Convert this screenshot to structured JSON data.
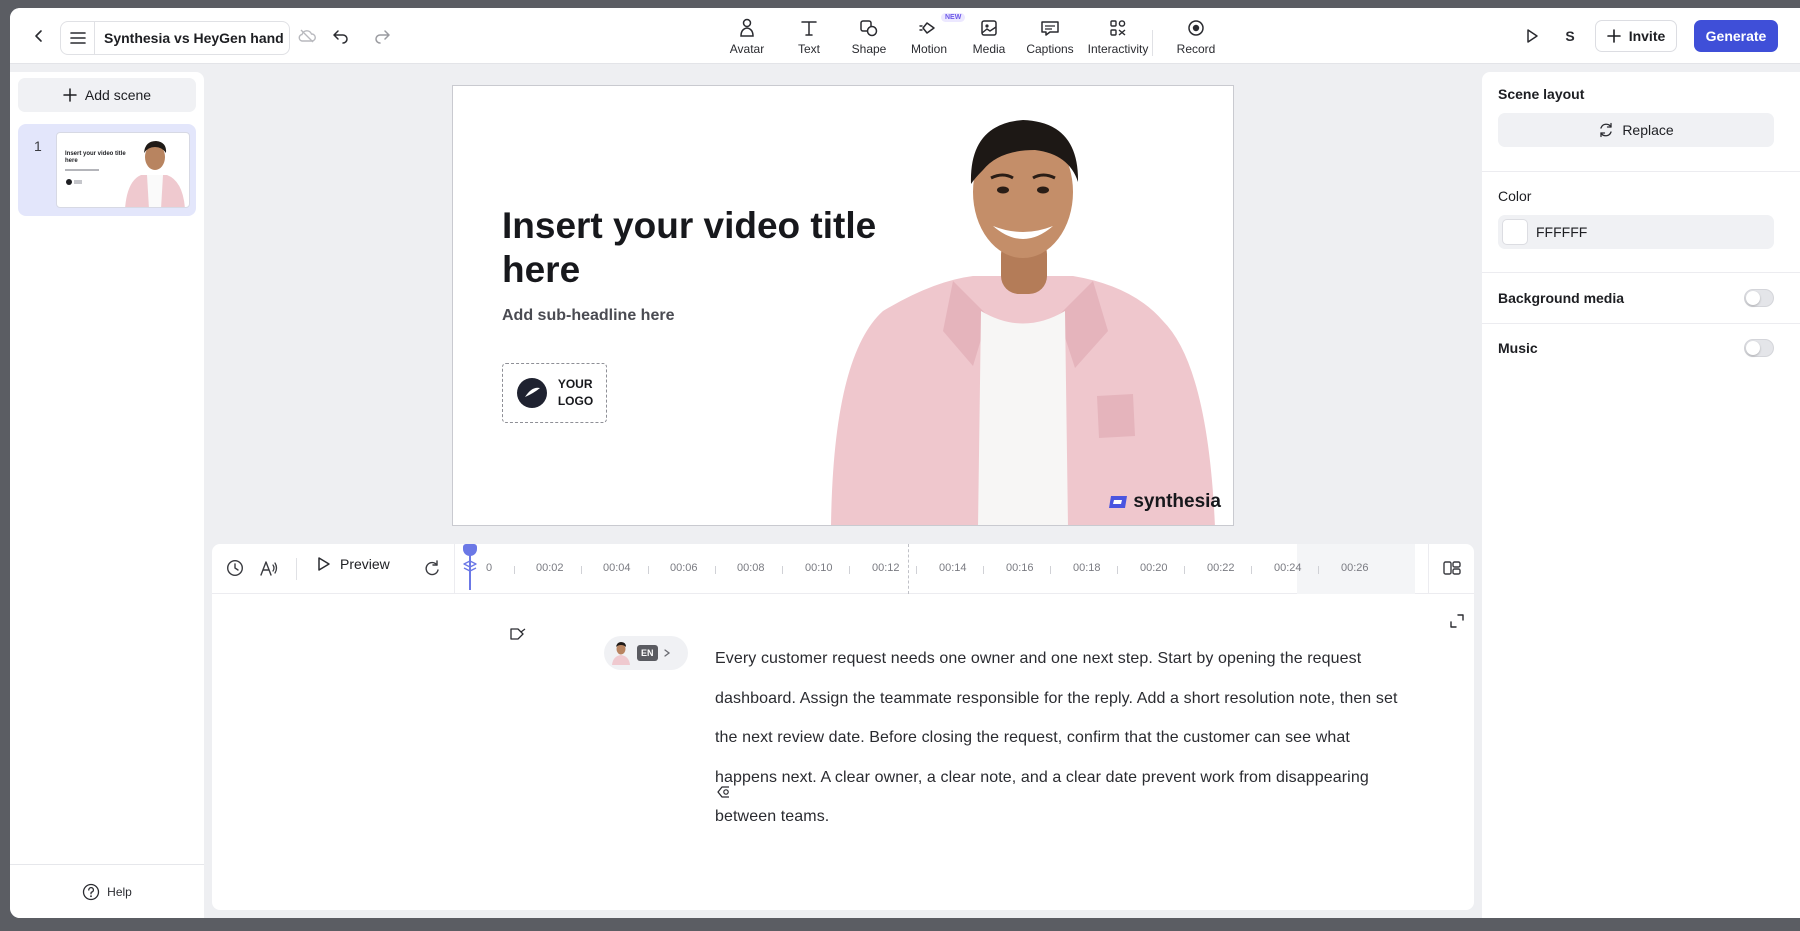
{
  "header": {
    "project_title": "Synthesia vs HeyGen hand",
    "tools": [
      {
        "label": "Avatar",
        "icon": "avatar-icon"
      },
      {
        "label": "Text",
        "icon": "text-icon"
      },
      {
        "label": "Shape",
        "icon": "shape-icon"
      },
      {
        "label": "Motion",
        "icon": "motion-icon",
        "badge": "NEW"
      },
      {
        "label": "Media",
        "icon": "media-icon"
      },
      {
        "label": "Captions",
        "icon": "captions-icon"
      },
      {
        "label": "Interactivity",
        "icon": "interactivity-icon"
      },
      {
        "label": "Record",
        "icon": "record-icon"
      }
    ],
    "user_initial": "S",
    "invite_label": "Invite",
    "generate_label": "Generate",
    "accent_color": "#3f4fd8"
  },
  "sidebar": {
    "add_scene_label": "Add scene",
    "scenes": [
      {
        "number": "1",
        "thumb_title": "Insert your video title here"
      }
    ],
    "help_label": "Help"
  },
  "canvas": {
    "title": "Insert your video title here",
    "subheadline": "Add sub-headline here",
    "logo_text_1": "YOUR",
    "logo_text_2": "LOGO",
    "brand": "synthesia"
  },
  "timeline": {
    "preview_label": "Preview",
    "ticks": [
      "0",
      "00:02",
      "00:04",
      "00:06",
      "00:08",
      "00:10",
      "00:12",
      "00:14",
      "00:16",
      "00:18",
      "00:20",
      "00:22",
      "00:24",
      "00:26"
    ]
  },
  "script": {
    "language": "EN",
    "text": "Every customer request needs one owner and one next step. Start by opening the request dashboard. Assign the teammate responsible for the reply. Add a short resolution note, then set the next review date. Before closing the request, confirm that the customer can see what happens next. A clear owner, a clear note, and a clear date prevent work from disappearing between teams."
  },
  "properties": {
    "scene_layout_label": "Scene layout",
    "replace_label": "Replace",
    "color_label": "Color",
    "color_value": "FFFFFF",
    "background_media_label": "Background media",
    "music_label": "Music"
  }
}
